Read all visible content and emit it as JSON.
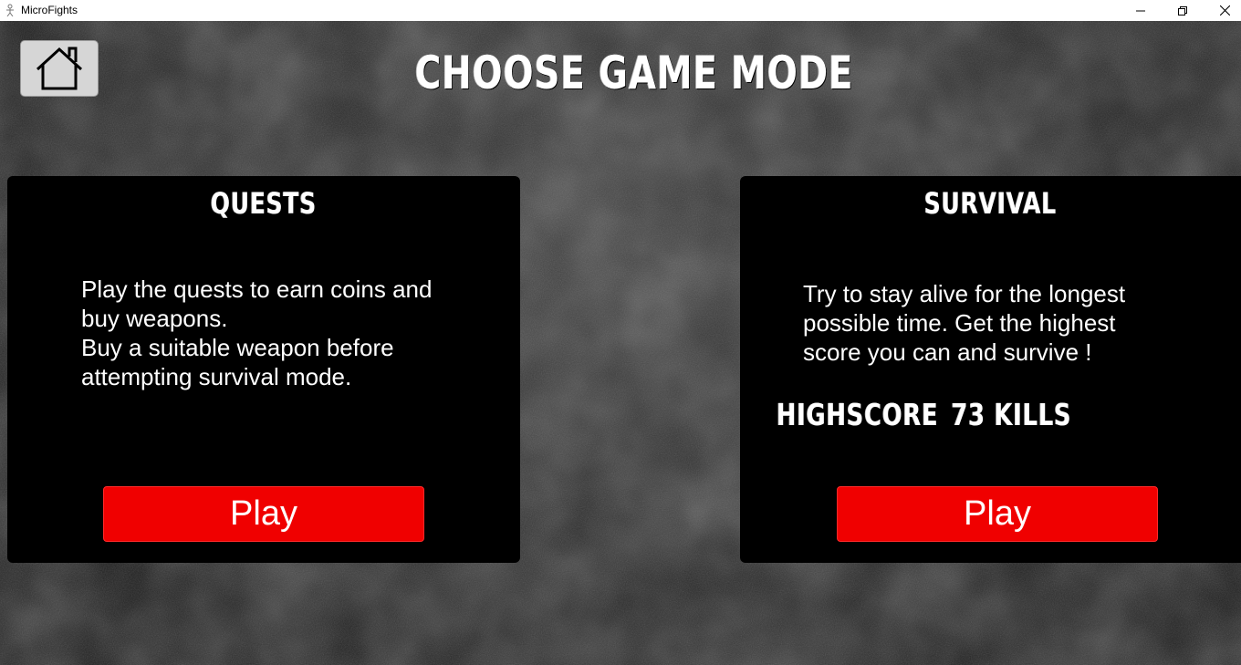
{
  "window": {
    "title": "MicroFights",
    "icons": [
      "app-icon",
      "minimize-icon",
      "maximize-icon",
      "close-icon"
    ]
  },
  "header": {
    "title": "CHOOSE GAME MODE",
    "home_icon": "home-icon"
  },
  "modes": {
    "quests": {
      "heading": "QUESTS",
      "desc_lines": [
        "Play the quests to earn coins and",
        "buy weapons.",
        "Buy a suitable weapon before",
        "attempting  survival mode."
      ],
      "play_label": "Play"
    },
    "survival": {
      "heading": "SURVIVAL",
      "desc_lines": [
        "Try to stay alive for the longest",
        "possible time. Get the highest",
        "score you can and survive !"
      ],
      "highscore_label": "HIGHSCORE",
      "highscore_value": "73 KILLS",
      "play_label": "Play"
    }
  },
  "colors": {
    "play_button": "#f00000",
    "card_bg": "#000000",
    "home_button_bg": "#d6d6d6"
  }
}
